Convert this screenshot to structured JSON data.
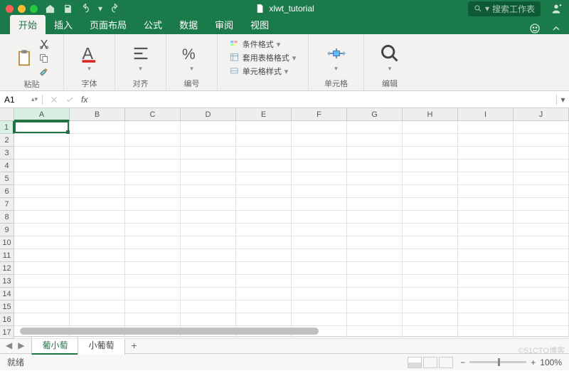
{
  "title": "xlwt_tutorial",
  "search_placeholder": "搜索工作表",
  "tabs": [
    "开始",
    "插入",
    "页面布局",
    "公式",
    "数据",
    "审阅",
    "视图"
  ],
  "active_tab": 0,
  "ribbon": {
    "paste": "粘贴",
    "font": "字体",
    "align": "对齐",
    "number": "编号",
    "cond_format": "条件格式",
    "table_style": "套用表格格式",
    "cell_style": "单元格样式",
    "cell": "单元格",
    "edit": "编辑"
  },
  "namebox": "A1",
  "columns": [
    "A",
    "B",
    "C",
    "D",
    "E",
    "F",
    "G",
    "H",
    "I",
    "J"
  ],
  "rows": [
    1,
    2,
    3,
    4,
    5,
    6,
    7,
    8,
    9,
    10,
    11,
    12,
    13,
    14,
    15,
    16,
    17
  ],
  "active": {
    "col": 0,
    "row": 0
  },
  "sheets": [
    "葡小萄",
    "小葡萄"
  ],
  "active_sheet": 0,
  "status": "就绪",
  "zoom": "100%",
  "watermark": "©51CTO博客"
}
